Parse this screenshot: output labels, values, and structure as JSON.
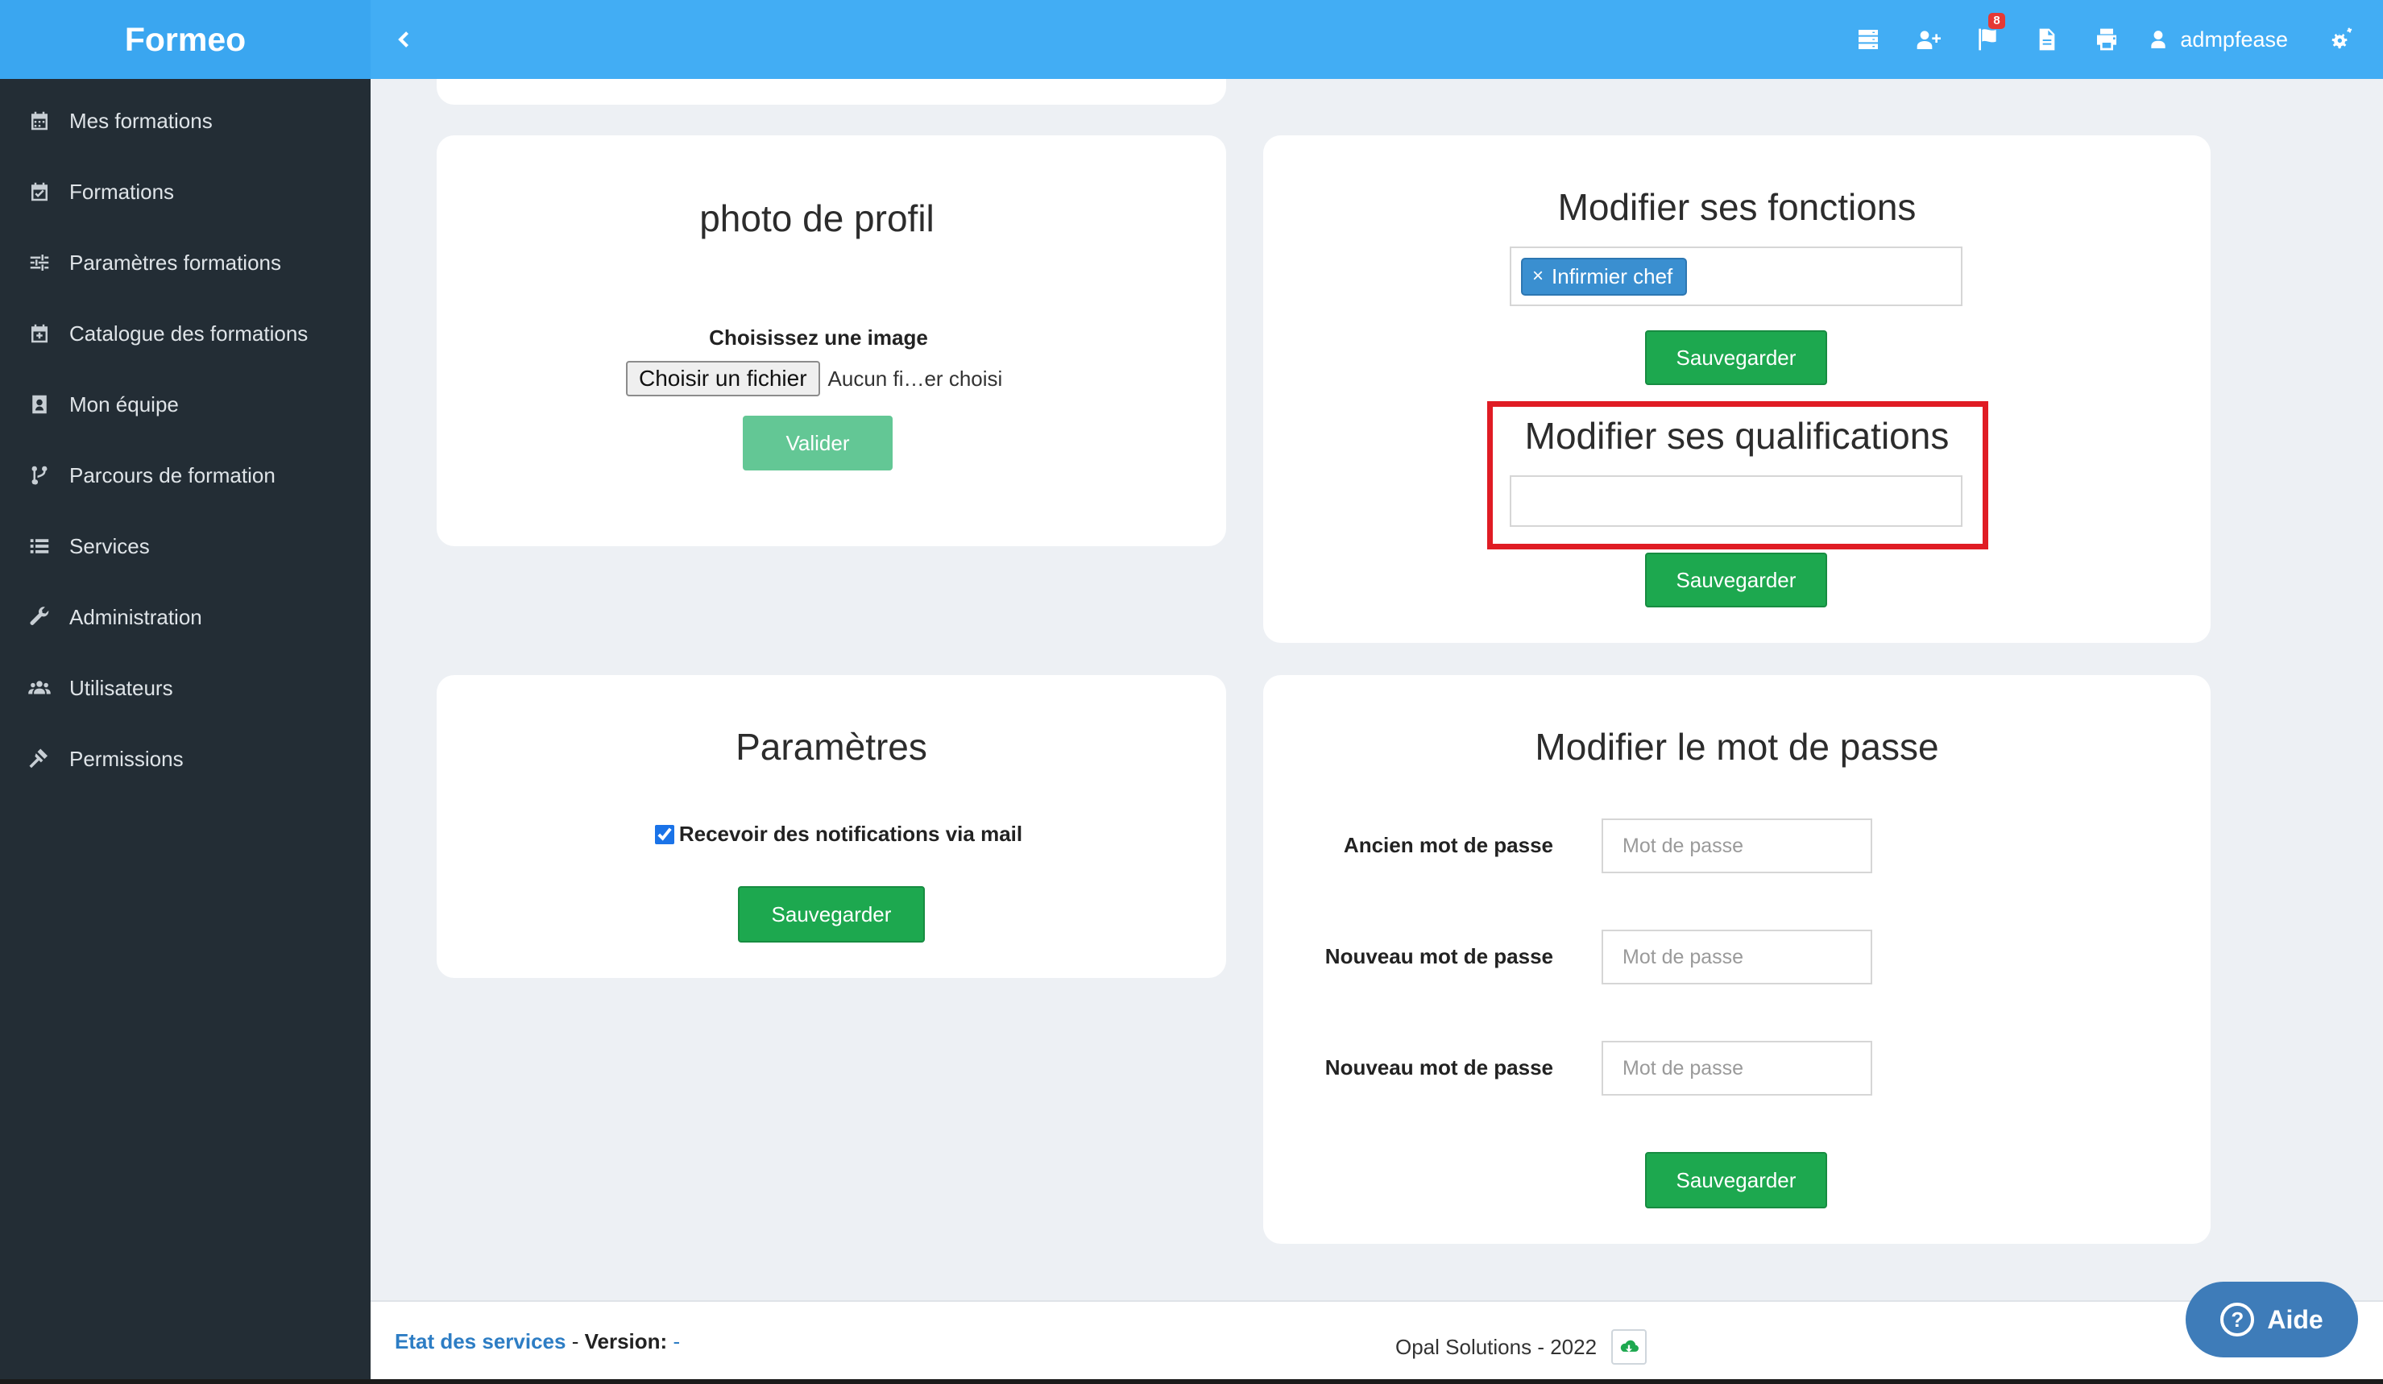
{
  "app": {
    "brand": "Formeo"
  },
  "sidebar": {
    "items": [
      {
        "label": "Mes formations",
        "icon": "calendar-icon"
      },
      {
        "label": "Formations",
        "icon": "calendar-check-icon"
      },
      {
        "label": "Paramètres formations",
        "icon": "sliders-icon"
      },
      {
        "label": "Catalogue des formations",
        "icon": "calendar-plus-icon"
      },
      {
        "label": "Mon équipe",
        "icon": "user-badge-icon"
      },
      {
        "label": "Parcours de formation",
        "icon": "code-branch-icon"
      },
      {
        "label": "Services",
        "icon": "list-icon"
      },
      {
        "label": "Administration",
        "icon": "wrench-icon"
      },
      {
        "label": "Utilisateurs",
        "icon": "users-icon"
      },
      {
        "label": "Permissions",
        "icon": "gavel-icon"
      }
    ]
  },
  "topbar": {
    "flag_badge": "8",
    "username": "admpfease"
  },
  "profile_photo": {
    "title": "photo de profil",
    "choose_label": "Choisissez une image",
    "file_button": "Choisir un fichier",
    "file_status": "Aucun fi…er choisi",
    "submit": "Valider"
  },
  "functions": {
    "title": "Modifier ses fonctions",
    "tags": [
      "Infirmier chef"
    ],
    "tag_remove": "×",
    "save": "Sauvegarder"
  },
  "qualifications": {
    "title": "Modifier ses qualifications",
    "save": "Sauvegarder"
  },
  "settings": {
    "title": "Paramètres",
    "notify_label": "Recevoir des notifications via mail",
    "notify_checked": true,
    "save": "Sauvegarder"
  },
  "password": {
    "title": "Modifier le mot de passe",
    "fields": [
      {
        "label": "Ancien mot de passe",
        "placeholder": "Mot de passe"
      },
      {
        "label": "Nouveau mot de passe",
        "placeholder": "Mot de passe"
      },
      {
        "label": "Nouveau mot de passe",
        "placeholder": "Mot de passe"
      }
    ],
    "save": "Sauvegarder"
  },
  "footer": {
    "status_link": "Etat des services",
    "separator": "-",
    "version_label": "Version:",
    "version_value": "-",
    "copyright": "Opal Solutions - 2022"
  },
  "help": {
    "label": "Aide"
  },
  "colors": {
    "topbar": "#42adf4",
    "sidebar": "#232d35",
    "primary_button": "#1da84f",
    "highlight": "#e01c24"
  }
}
